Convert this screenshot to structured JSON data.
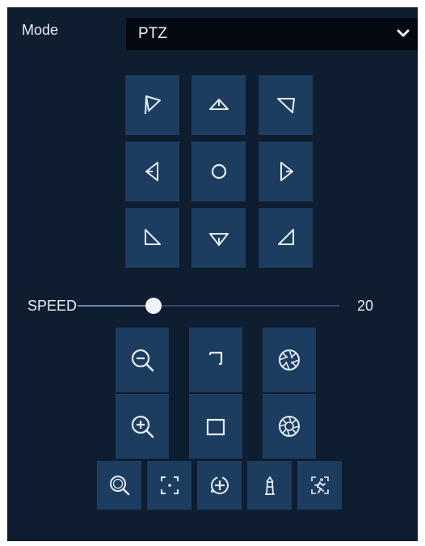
{
  "mode": {
    "label": "Mode",
    "value": "PTZ"
  },
  "speed": {
    "label": "SPEED",
    "value": "20",
    "fraction": 0.29
  },
  "direction_pad": [
    {
      "name": "pan-up-left-button",
      "icon": "arrow-up-left-icon"
    },
    {
      "name": "tilt-up-button",
      "icon": "arrow-up-icon"
    },
    {
      "name": "pan-up-right-button",
      "icon": "arrow-up-right-icon"
    },
    {
      "name": "pan-left-button",
      "icon": "arrow-left-icon"
    },
    {
      "name": "home-center-button",
      "icon": "circle-center-icon"
    },
    {
      "name": "pan-right-button",
      "icon": "arrow-right-icon"
    },
    {
      "name": "pan-down-left-button",
      "icon": "arrow-down-left-icon"
    },
    {
      "name": "tilt-down-button",
      "icon": "arrow-down-icon"
    },
    {
      "name": "pan-down-right-button",
      "icon": "arrow-down-right-icon"
    }
  ],
  "lens_controls": [
    {
      "name": "zoom-out-button",
      "icon": "zoom-out-icon"
    },
    {
      "name": "focus-near-button",
      "icon": "focus-near-icon"
    },
    {
      "name": "iris-close-button",
      "icon": "aperture-icon"
    },
    {
      "name": "zoom-in-button",
      "icon": "zoom-in-icon"
    },
    {
      "name": "focus-far-button",
      "icon": "focus-far-icon"
    },
    {
      "name": "iris-open-button",
      "icon": "aperture-icon"
    }
  ],
  "function_buttons": [
    {
      "name": "zoom-3d-button",
      "icon": "zoom-3d-icon"
    },
    {
      "name": "center-position-button",
      "icon": "crosshair-frame-icon"
    },
    {
      "name": "preset-button",
      "icon": "target-icon"
    },
    {
      "name": "light-button",
      "icon": "lighthouse-icon"
    },
    {
      "name": "auto-tracking-button",
      "icon": "running-person-icon"
    }
  ],
  "colors": {
    "panel_bg": "#0f1d30",
    "button_bg": "#1c3d60",
    "select_bg": "#050a12",
    "icon_stroke": "#e6edf5"
  }
}
